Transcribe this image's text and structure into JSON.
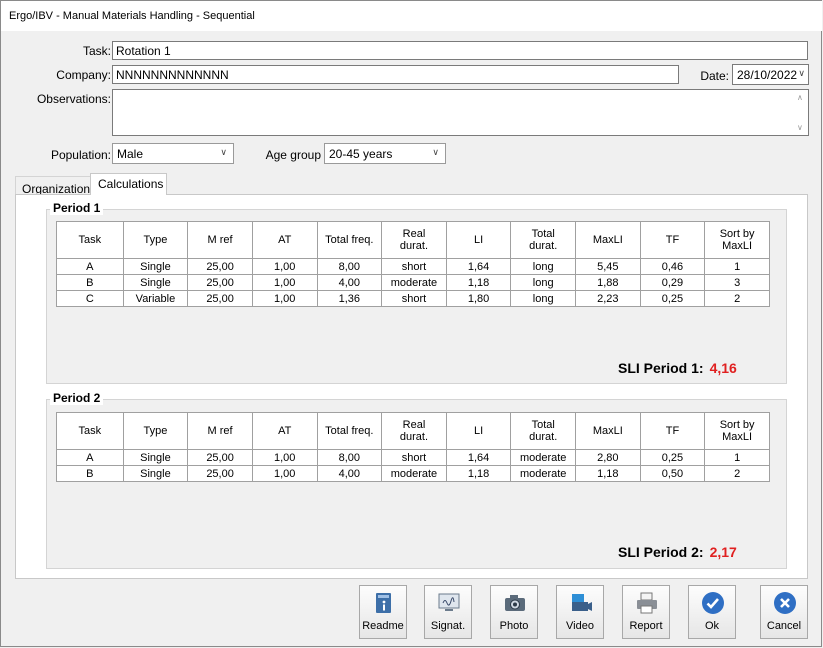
{
  "window": {
    "title": "Ergo/IBV - Manual Materials Handling - Sequential"
  },
  "form": {
    "task_label": "Task:",
    "task_value": "Rotation 1",
    "company_label": "Company:",
    "company_value": "NNNNNNNNNNNNN",
    "date_label": "Date:",
    "date_value": "28/10/2022",
    "observations_label": "Observations:",
    "observations_value": "",
    "population_label": "Population:",
    "population_value": "Male",
    "age_group_label": "Age group",
    "age_group_value": "20-45 years"
  },
  "tabs": [
    {
      "label": "Organization"
    },
    {
      "label": "Calculations"
    }
  ],
  "columns": [
    "Task",
    "Type",
    "M ref",
    "AT",
    "Total freq.",
    "Real\ndurat.",
    "LI",
    "Total\ndurat.",
    "MaxLI",
    "TF",
    "Sort by\nMaxLI"
  ],
  "period1": {
    "title": "Period 1",
    "rows": [
      [
        "A",
        "Single",
        "25,00",
        "1,00",
        "8,00",
        "short",
        "1,64",
        "long",
        "5,45",
        "0,46",
        "1"
      ],
      [
        "B",
        "Single",
        "25,00",
        "1,00",
        "4,00",
        "moderate",
        "1,18",
        "long",
        "1,88",
        "0,29",
        "3"
      ],
      [
        "C",
        "Variable",
        "25,00",
        "1,00",
        "1,36",
        "short",
        "1,80",
        "long",
        "2,23",
        "0,25",
        "2"
      ]
    ],
    "sli_label": "SLI Period 1:",
    "sli_value": "4,16"
  },
  "period2": {
    "title": "Period 2",
    "rows": [
      [
        "A",
        "Single",
        "25,00",
        "1,00",
        "8,00",
        "short",
        "1,64",
        "moderate",
        "2,80",
        "0,25",
        "1"
      ],
      [
        "B",
        "Single",
        "25,00",
        "1,00",
        "4,00",
        "moderate",
        "1,18",
        "moderate",
        "1,18",
        "0,50",
        "2"
      ]
    ],
    "sli_label": "SLI Period 2:",
    "sli_value": "2,17"
  },
  "buttons": [
    {
      "label": "Readme",
      "icon": "readme-icon"
    },
    {
      "label": "Signat.",
      "icon": "signature-icon"
    },
    {
      "label": "Photo",
      "icon": "camera-icon"
    },
    {
      "label": "Video",
      "icon": "video-icon"
    },
    {
      "label": "Report",
      "icon": "printer-icon"
    },
    {
      "label": "Ok",
      "icon": "check-icon"
    },
    {
      "label": "Cancel",
      "icon": "close-icon"
    }
  ],
  "colors": {
    "sli_value": "#e02020",
    "ok_blue": "#2f6fc4",
    "cancel_blue": "#2f6fc4"
  }
}
